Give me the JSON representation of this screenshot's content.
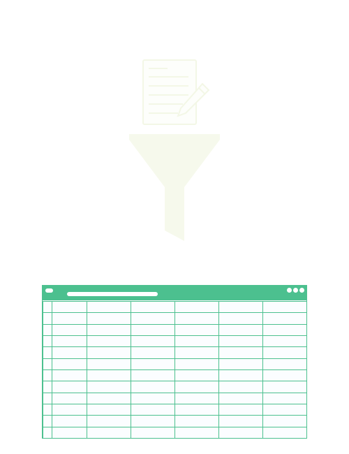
{
  "colors": {
    "accent": "#4cc08f",
    "illustration": "#f6f9ec",
    "grid_fill": "#fbfdff"
  },
  "illustration": {
    "icons": [
      "document-icon",
      "pencil-icon",
      "funnel-icon"
    ]
  },
  "spreadsheet": {
    "icons": [
      "window-control-dot",
      "window-control-dot",
      "window-control-dot"
    ],
    "columns": 7,
    "rows": 12
  }
}
